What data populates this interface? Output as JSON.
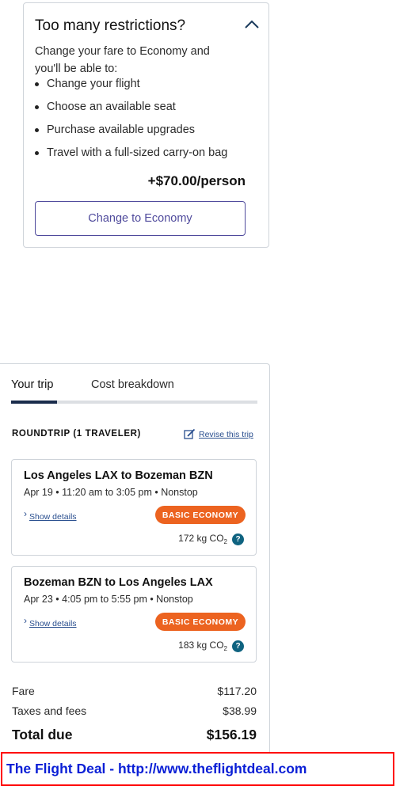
{
  "restrictions": {
    "title": "Too many restrictions?",
    "intro": "Change your fare to Economy and you'll be able to:",
    "benefits": [
      "Change your flight",
      "Choose an available seat",
      "Purchase available upgrades",
      "Travel with a full-sized carry-on bag"
    ],
    "price": "+$70.00/person",
    "button_label": "Change to Economy"
  },
  "trip": {
    "tabs": [
      "Your trip",
      "Cost breakdown"
    ],
    "active_tab": "Your trip",
    "heading": "ROUNDTRIP (1 TRAVELER)",
    "revise_label": "Revise this trip",
    "flights": [
      {
        "route": "Los Angeles LAX to Bozeman BZN",
        "times": "Apr 19 • 11:20 am to 3:05 pm • Nonstop",
        "details_label": "Show details",
        "fare_class": "BASIC ECONOMY",
        "co2_value": "172 kg CO",
        "co2_sub": "2"
      },
      {
        "route": "Bozeman BZN to Los Angeles LAX",
        "times": "Apr 23 • 4:05 pm to 5:55 pm • Nonstop",
        "details_label": "Show details",
        "fare_class": "BASIC ECONOMY",
        "co2_value": "183 kg CO",
        "co2_sub": "2"
      }
    ],
    "costs": {
      "fare_label": "Fare",
      "fare_value": "$117.20",
      "taxes_label": "Taxes and fees",
      "taxes_value": "$38.99",
      "total_label": "Total due",
      "total_value": "$156.19"
    }
  },
  "watermark": "The Flight Deal - http://www.theflightdeal.com",
  "colors": {
    "brand_purple": "#4f4a9c",
    "badge_orange": "#ec6320",
    "link_blue": "#2a4f8f",
    "tab_active": "#1a2c4c",
    "help_teal": "#0f6380",
    "watermark_blue": "#0a1fd6",
    "watermark_border": "#ff0000"
  },
  "icons": {
    "collapse": "chevron-up-icon",
    "revise": "edit-icon",
    "details": "chevron-right-icon",
    "co2_help": "question-icon"
  }
}
